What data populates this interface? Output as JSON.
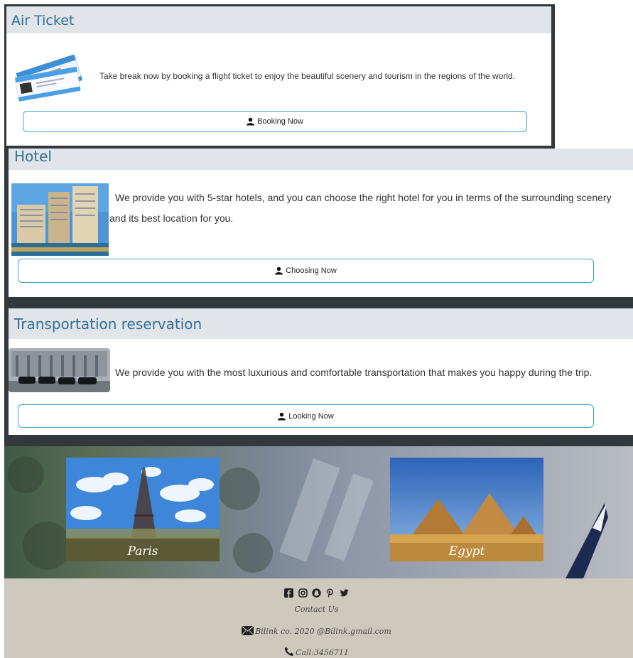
{
  "air_ticket": {
    "title": "Air Ticket",
    "description": "Take break now by booking a flight ticket to enjoy the beautiful scenery and tourism in the regions of the world.",
    "button_label": "Booking Now"
  },
  "hotel": {
    "title": "Hotel",
    "description_line1": "We provide you with 5-star hotels, and you can choose the right hotel for you in terms of the surrounding scenery",
    "description_line2": "and its best location for you.",
    "button_label": "Choosing Now"
  },
  "transport": {
    "title": "Transportation reservation",
    "description": "We provide you with the most luxurious and comfortable transportation that makes you happy during the trip.",
    "button_label": "Looking Now"
  },
  "destinations": [
    {
      "caption": "Paris"
    },
    {
      "caption": "Egypt"
    }
  ],
  "footer": {
    "social_icons": [
      "facebook-icon",
      "instagram-icon",
      "snapchat-icon",
      "pinterest-icon",
      "twitter-icon"
    ],
    "contact_label": "Contact Us",
    "email_text": "Bilink co. 2020 @Bilink.gmail.com",
    "phone_text": "Call:3456711",
    "background_color": "#cdc9bd"
  },
  "colors": {
    "header_text": "#2f6f96",
    "header_bg": "#e1e4e8",
    "button_border": "#3aa1d1",
    "dark_frame": "#33383d"
  }
}
